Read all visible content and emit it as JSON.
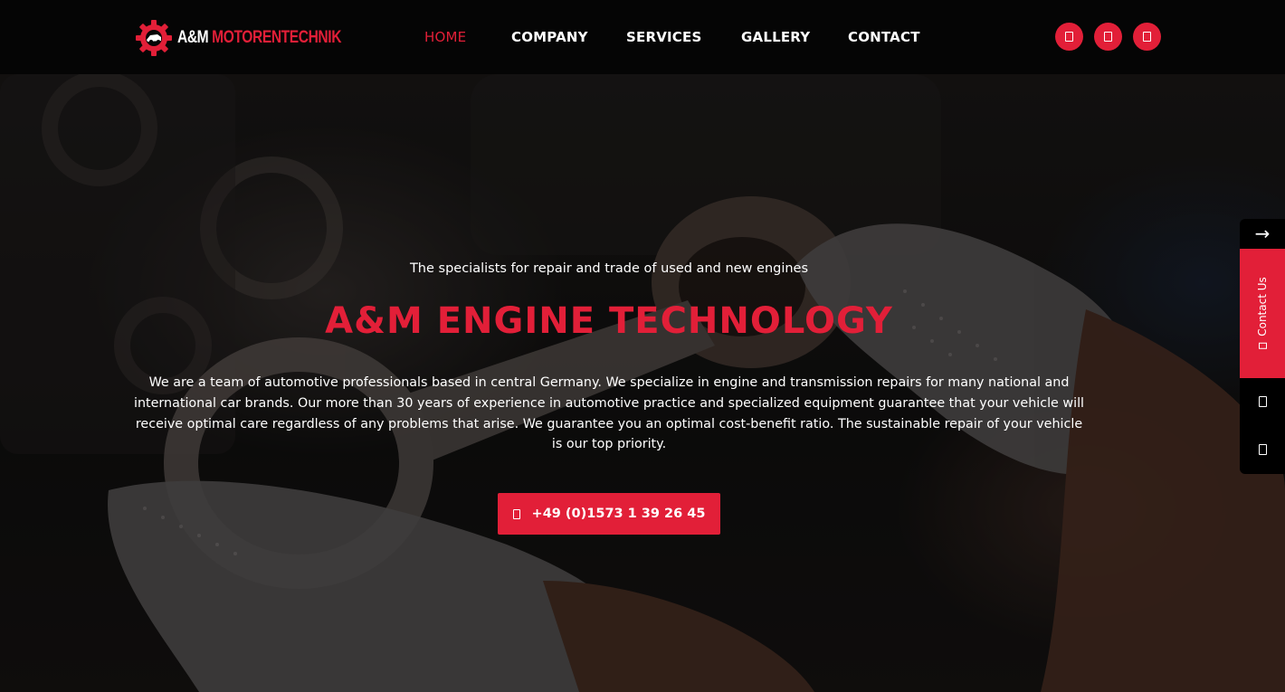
{
  "header": {
    "logo": {
      "part1": "A&M",
      "part2": "MOTORENTECHNIK"
    },
    "nav": [
      {
        "label": "HOME",
        "active": true
      },
      {
        "label": "COMPANY",
        "active": false
      },
      {
        "label": "SERVICES",
        "active": false
      },
      {
        "label": "GALLERY",
        "active": false
      },
      {
        "label": "CONTACT",
        "active": false
      }
    ],
    "social_icons": [
      "social-icon-1",
      "social-icon-2",
      "social-icon-3"
    ]
  },
  "hero": {
    "tagline": "The specialists for repair and trade of used and new engines",
    "title": "A&M ENGINE TECHNOLOGY",
    "body": "We are a team of automotive professionals based in central Germany. We specialize in engine and transmission repairs for many national and international car brands. Our more than 30 years of experience in automotive practice and specialized equipment guarantee that your vehicle will receive optimal care regardless of any problems that arise. We guarantee you an optimal cost-benefit ratio. The sustainable repair of your vehicle is our top priority.",
    "phone": "+49 (0)1573 1 39 26 45",
    "phone_icon": "phone-icon"
  },
  "side_widget": {
    "arrow": "→",
    "contact_label": "Contact Us",
    "icons": [
      "side-icon-1",
      "side-icon-2"
    ]
  },
  "colors": {
    "accent": "#e21f38",
    "header_bg": "#050505",
    "text": "#ffffff"
  }
}
